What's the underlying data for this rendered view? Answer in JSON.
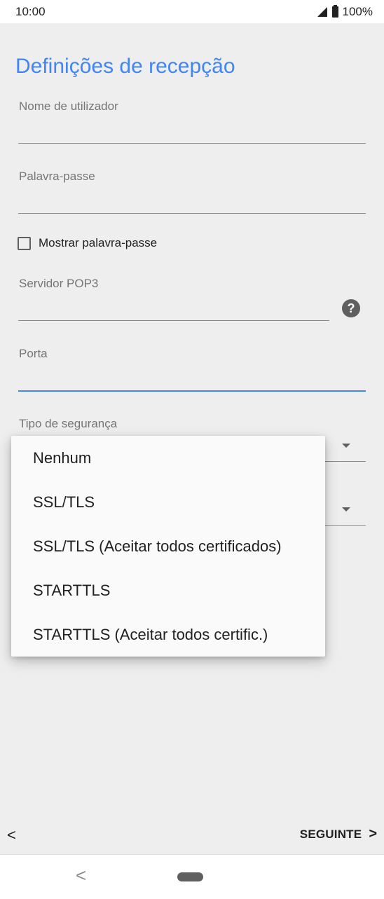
{
  "status": {
    "time": "10:00",
    "battery": "100%"
  },
  "page": {
    "title": "Definições de recepção"
  },
  "fields": {
    "username_label": "Nome de utilizador",
    "password_label": "Palavra-passe",
    "show_password_label": "Mostrar palavra-passe",
    "server_label": "Servidor POP3",
    "port_label": "Porta",
    "security_label": "Tipo de segurança"
  },
  "dropdown": {
    "options": [
      "Nenhum",
      "SSL/TLS",
      "SSL/TLS (Aceitar todos certificados)",
      "STARTTLS",
      "STARTTLS (Aceitar todos certific.)"
    ]
  },
  "footer": {
    "back": "<",
    "next_label": "SEGUINTE",
    "next_chevron": ">"
  },
  "navbar": {
    "back": "<"
  },
  "colors": {
    "accent": "#4285f4",
    "background": "#eeeeee"
  }
}
